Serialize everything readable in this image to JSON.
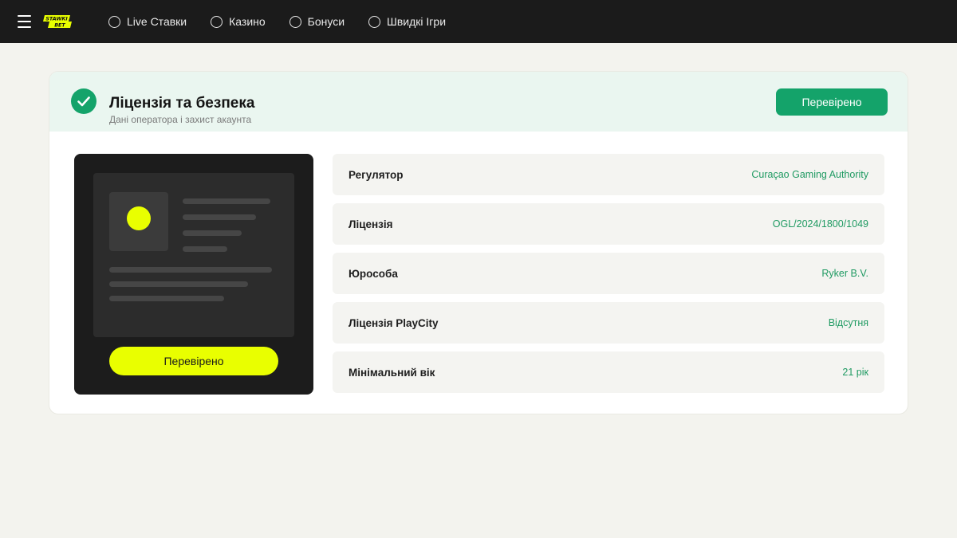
{
  "header": {
    "logo_text": "STAWKI BET",
    "nav": [
      {
        "label": "Live Ставки"
      },
      {
        "label": "Казино"
      },
      {
        "label": "Бонуси"
      },
      {
        "label": "Швидкі Ігри"
      }
    ]
  },
  "card": {
    "title": "Ліцензія та безпека",
    "subtitle": "Дані оператора і захист акаунта",
    "verified_label": "Перевірено",
    "preview_button": "Перевірено",
    "rows": [
      {
        "label": "Регулятор",
        "value": "Curaçao Gaming Authority"
      },
      {
        "label": "Ліцензія",
        "value": "OGL/2024/1800/1049"
      },
      {
        "label": "Юрособа",
        "value": "Ryker B.V."
      },
      {
        "label": "Ліцензія PlayCity",
        "value": "Відсутня"
      },
      {
        "label": "Мінімальний вік",
        "value": "21 рік"
      }
    ]
  },
  "colors": {
    "accent_green": "#14a36a",
    "brand_yellow": "#e9ff00",
    "topbar": "#1b1b1b"
  },
  "icons": [
    "menu-icon",
    "check-icon",
    "radio-ring-icon"
  ]
}
